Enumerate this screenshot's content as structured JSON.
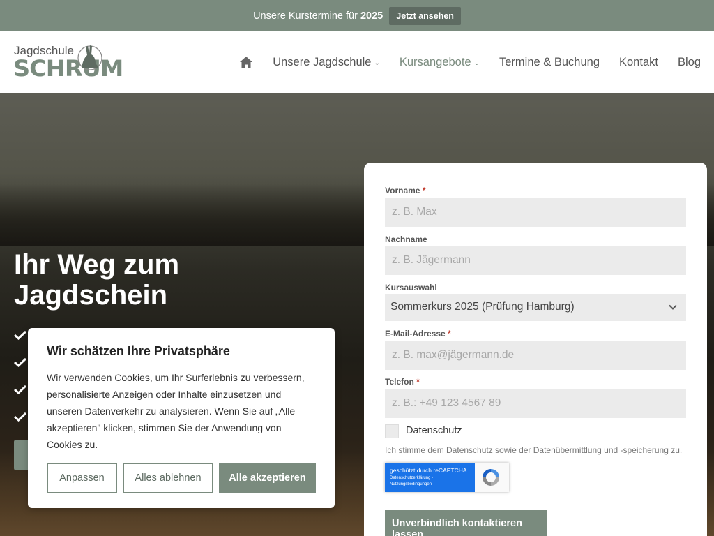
{
  "topbar": {
    "text_prefix": "Unsere Kurstermine für ",
    "year": "2025",
    "button_label": "Jetzt ansehen"
  },
  "logo": {
    "line1": "Jagdschule",
    "line2": "SCHRUM"
  },
  "nav": {
    "home_icon": "home-icon",
    "items": [
      {
        "label": "Unsere Jagdschule",
        "has_dropdown": true,
        "active": false
      },
      {
        "label": "Kursangebote",
        "has_dropdown": true,
        "active": true
      },
      {
        "label": "Termine & Buchung",
        "has_dropdown": false,
        "active": false
      },
      {
        "label": "Kontakt",
        "has_dropdown": false,
        "active": false
      },
      {
        "label": "Blog",
        "has_dropdown": false,
        "active": false
      }
    ]
  },
  "hero": {
    "title_line1": "Ihr Weg zum",
    "title_line2": "Jagdschein"
  },
  "form": {
    "vorname": {
      "label": "Vorname",
      "required_mark": "*",
      "placeholder": "z. B. Max"
    },
    "nachname": {
      "label": "Nachname",
      "placeholder": "z. B. Jägermann"
    },
    "kurs": {
      "label": "Kursauswahl",
      "selected": "Sommerkurs 2025 (Prüfung Hamburg)"
    },
    "email": {
      "label": "E-Mail-Adresse",
      "required_mark": "*",
      "placeholder": "z. B. max@jägermann.de"
    },
    "telefon": {
      "label": "Telefon",
      "required_mark": "*",
      "placeholder": "z. B.: +49 123 4567 89"
    },
    "datenschutz_label": "Datenschutz",
    "consent_text": "Ich stimme dem Datenschutz sowie der Datenübermittlung und -speicherung zu.",
    "recaptcha": {
      "line1": "geschützt durch reCAPTCHA",
      "line2": "Datenschutzerklärung -",
      "line3": "Nutzungsbedingungen"
    },
    "submit_label": "Unverbindlich kontaktieren lassen"
  },
  "cookie": {
    "title": "Wir schätzen Ihre Privatsphäre",
    "text": "Wir verwenden Cookies, um Ihr Surferlebnis zu verbessern, personalisierte Anzeigen oder Inhalte einzusetzen und unseren Datenverkehr zu analysieren. Wenn Sie auf „Alle akzeptieren\" klicken, stimmen Sie der Anwendung von Cookies zu.",
    "btn_customize": "Anpassen",
    "btn_reject": "Alles ablehnen",
    "btn_accept": "Alle akzeptieren"
  },
  "colors": {
    "accent": "#7a8b7e",
    "accent_dark": "#5e6b62",
    "required": "#c0392b",
    "recaptcha_blue": "#1a73e8"
  }
}
